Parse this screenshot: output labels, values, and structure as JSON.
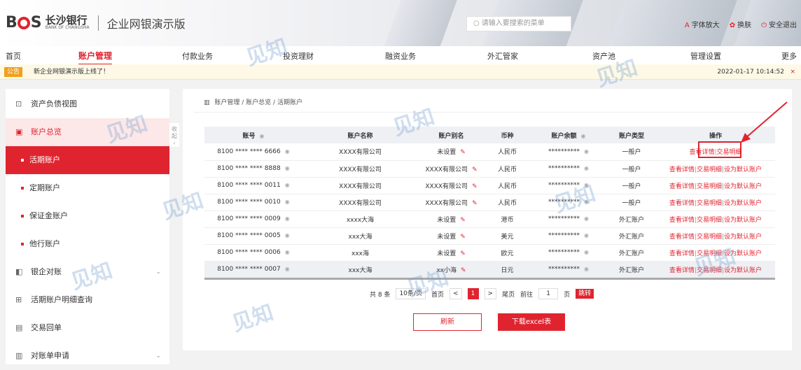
{
  "brand": {
    "abbr_b": "B",
    "abbr_s": "S",
    "name_cn": "长沙银行",
    "name_en": "BANK OF CHANGSHA",
    "title": "企业网银演示版"
  },
  "search": {
    "placeholder": "请输入要搜索的菜单"
  },
  "toplinks": [
    {
      "icon": "font-size-icon",
      "glyph": "A",
      "label": "字体放大"
    },
    {
      "icon": "skin-icon",
      "glyph": "✿",
      "label": "换肤"
    },
    {
      "icon": "logout-icon",
      "glyph": "⏻",
      "label": "安全退出"
    }
  ],
  "nav": [
    "首页",
    "账户管理",
    "付款业务",
    "投资理财",
    "融资业务",
    "外汇管家",
    "资产池",
    "管理设置",
    "更多"
  ],
  "notice": {
    "badge": "公告",
    "text": "新企业网银演示版上线了！",
    "time": "2022-01-17 10:14:52",
    "close": "×"
  },
  "sidebar": {
    "collapse": "收起",
    "items": [
      {
        "label": "资产负债视图",
        "icon": "chart-icon",
        "glyph": "⊡"
      },
      {
        "label": "账户总览",
        "icon": "account-icon",
        "glyph": "▣"
      },
      {
        "label": "活期账户"
      },
      {
        "label": "定期账户"
      },
      {
        "label": "保证金账户"
      },
      {
        "label": "他行账户"
      },
      {
        "label": "银企对账",
        "icon": "reconcile-icon",
        "glyph": "◧"
      },
      {
        "label": "活期账户明细查询",
        "icon": "query-icon",
        "glyph": "⊞"
      },
      {
        "label": "交易回单",
        "icon": "receipt-icon",
        "glyph": "▤"
      },
      {
        "label": "对账单申请",
        "icon": "statement-icon",
        "glyph": "▥"
      }
    ]
  },
  "breadcrumb": [
    "账户管理",
    "账户总览",
    "活期账户"
  ],
  "table": {
    "headers": [
      "账号",
      "账户名称",
      "账户别名",
      "币种",
      "账户余额",
      "账户类型",
      "操作"
    ],
    "rows": [
      {
        "acct": "8100 **** **** 6666",
        "name": "XXXX有限公司",
        "alias": "未设置",
        "cur": "人民币",
        "bal": "**********",
        "type": "一般户"
      },
      {
        "acct": "8100 **** **** 8888",
        "name": "XXXX有限公司",
        "alias": "XXXX有限公司",
        "cur": "人民币",
        "bal": "**********",
        "type": "一般户"
      },
      {
        "acct": "8100 **** **** 0011",
        "name": "XXXX有限公司",
        "alias": "XXXX有限公司",
        "cur": "人民币",
        "bal": "**********",
        "type": "一般户"
      },
      {
        "acct": "8100 **** **** 0010",
        "name": "XXXX有限公司",
        "alias": "XXXX有限公司",
        "cur": "人民币",
        "bal": "**********",
        "type": "一般户"
      },
      {
        "acct": "8100 **** **** 0009",
        "name": "xxxx大海",
        "alias": "未设置",
        "cur": "港币",
        "bal": "**********",
        "type": "外汇账户"
      },
      {
        "acct": "8100 **** **** 0005",
        "name": "xxx大海",
        "alias": "未设置",
        "cur": "美元",
        "bal": "**********",
        "type": "外汇账户"
      },
      {
        "acct": "8100 **** **** 0006",
        "name": "xxx海",
        "alias": "未设置",
        "cur": "欧元",
        "bal": "**********",
        "type": "外汇账户"
      },
      {
        "acct": "8100 **** **** 0007",
        "name": "xxx大海",
        "alias": "xx小海",
        "cur": "日元",
        "bal": "**********",
        "type": "外汇账户"
      }
    ],
    "ops": {
      "detail": "查看详情",
      "trans": "交易明细",
      "default": "设为默认账户"
    }
  },
  "pager": {
    "total": "共 8 条",
    "size": "10条/页",
    "first": "首页",
    "prev": "<",
    "current": "1",
    "next": ">",
    "last": "尾页",
    "goto": "前往",
    "goto_value": "1",
    "page_unit": "页",
    "jump": "跳转"
  },
  "buttons": {
    "refresh": "刷新",
    "export": "下载excel表"
  },
  "watermark": {
    "cn": "见知",
    "en": "XENCIO.COM"
  },
  "colors": {
    "accent": "#e0242f"
  }
}
